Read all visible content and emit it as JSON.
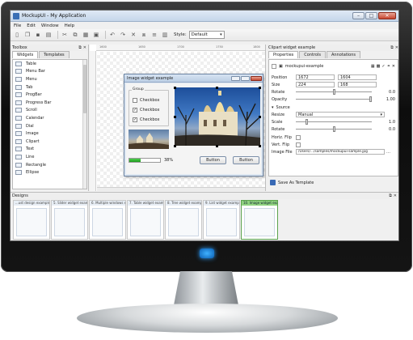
{
  "window": {
    "title": "MockupUI - My Application"
  },
  "menu": [
    "File",
    "Edit",
    "Window",
    "Help"
  ],
  "toolbar": {
    "style_label": "Style:",
    "style_value": "Default"
  },
  "toolbox": {
    "title": "Toolbox",
    "tabs": [
      "Widgets",
      "Templates"
    ],
    "items": [
      {
        "label": "Table",
        "icon": "table-icon"
      },
      {
        "label": "Menu Bar",
        "icon": "menu-bar-icon"
      },
      {
        "label": "Menu",
        "icon": "menu-icon"
      },
      {
        "label": "Tab",
        "icon": "tab-icon"
      },
      {
        "label": "ProgBar",
        "icon": "progress-bar-icon"
      },
      {
        "label": "Progress Bar",
        "icon": "progress-bar-icon"
      },
      {
        "label": "Scroll",
        "icon": "scroll-icon"
      },
      {
        "label": "Calendar",
        "icon": "calendar-icon"
      },
      {
        "label": "Dial",
        "icon": "dial-icon"
      },
      {
        "label": "Image",
        "icon": "image-icon"
      },
      {
        "label": "Clipart",
        "icon": "clipart-icon"
      },
      {
        "label": "Text",
        "icon": "text-icon"
      },
      {
        "label": "Line",
        "icon": "line-icon"
      },
      {
        "label": "Rectangle",
        "icon": "rectangle-icon"
      },
      {
        "label": "Ellipse",
        "icon": "ellipse-icon"
      }
    ]
  },
  "canvas": {
    "rulers": [
      "1600",
      "1650",
      "1700",
      "1750",
      "1800"
    ],
    "mock_window": {
      "title": "Image widget example",
      "group_label": "Group",
      "checkboxes": [
        {
          "label": "Checkbox",
          "checked": false
        },
        {
          "label": "Checkbox",
          "checked": true
        },
        {
          "label": "Checkbox",
          "checked": true
        }
      ],
      "progress": {
        "value": 0.38,
        "text": "38%"
      },
      "buttons": [
        "Button",
        "Button"
      ]
    }
  },
  "properties": {
    "title": "Clipart widget example",
    "tabs": [
      "Properties",
      "Controls",
      "Annotations"
    ],
    "name": "mockupui-example",
    "position": [
      "1672",
      "1604"
    ],
    "size": [
      "224",
      "168"
    ],
    "rotate": "0.0",
    "opacity": "1.00",
    "source_label": "Source",
    "resize": "Manual",
    "scale": "1.0",
    "rotate2": "0.0",
    "horiz_flip_label": "Horiz. Flip",
    "vert_flip_label": "Vert. Flip",
    "image_file": "/Users/.../samples/mockupui-sample.jpg",
    "labels": {
      "position": "Position",
      "size": "Size",
      "rotate": "Rotate",
      "opacity": "Opacity",
      "resize": "Resize",
      "scale": "Scale",
      "image_file": "Image File"
    },
    "save_template": "Save As Template"
  },
  "designs": {
    "title": "Designs",
    "items": [
      "...ust design example",
      "5. Slider widget example",
      "6. Multiple windows example",
      "7. Table widget example",
      "8. Tree widget example",
      "9. List widget example",
      "10. Image widget example"
    ],
    "active_index": 6
  },
  "colors": {
    "accent": "#3a6fb5",
    "progress": "#2fb52f",
    "active_design": "#8fd27f"
  }
}
